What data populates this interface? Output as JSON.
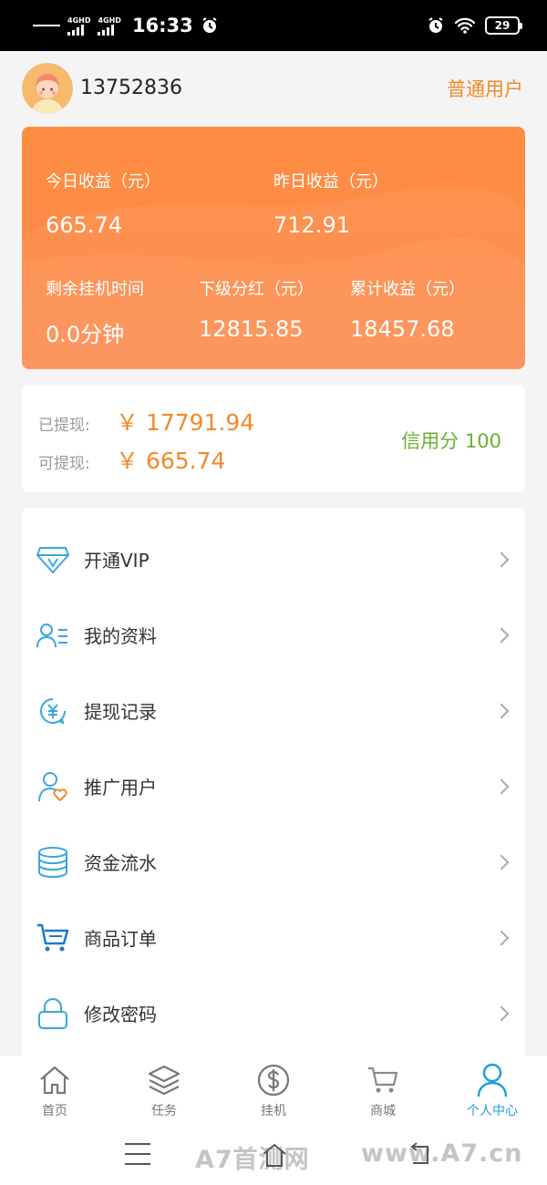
{
  "status_bar": {
    "signal1_label": "4GHD",
    "signal2_label": "4GHD",
    "time": "16:33",
    "battery": "29"
  },
  "header": {
    "username": "13752836",
    "user_level": "普通用户"
  },
  "earnings": {
    "today": {
      "label": "今日收益（元）",
      "value": "665.74"
    },
    "yesterday": {
      "label": "昨日收益（元）",
      "value": "712.91"
    },
    "remaining": {
      "label": "剩余挂机时间",
      "value": "0.0分钟"
    },
    "sub_bonus": {
      "label": "下级分红（元）",
      "value": "12815.85"
    },
    "total": {
      "label": "累计收益（元）",
      "value": "18457.68"
    }
  },
  "withdraw": {
    "withdrawn_label": "已提现:",
    "withdrawn_value": "￥ 17791.94",
    "available_label": "可提现:",
    "available_value": "￥ 665.74",
    "credit": "信用分 100"
  },
  "menu": [
    {
      "label": "开通VIP",
      "icon": "diamond-vip-icon"
    },
    {
      "label": "我的资料",
      "icon": "user-profile-icon"
    },
    {
      "label": "提现记录",
      "icon": "yuan-record-icon"
    },
    {
      "label": "推广用户",
      "icon": "user-heart-icon"
    },
    {
      "label": "资金流水",
      "icon": "coin-stack-icon"
    },
    {
      "label": "商品订单",
      "icon": "cart-icon"
    },
    {
      "label": "修改密码",
      "icon": "lock-icon"
    }
  ],
  "tabs": [
    {
      "label": "首页",
      "icon": "home-icon"
    },
    {
      "label": "任务",
      "icon": "layers-icon"
    },
    {
      "label": "挂机",
      "icon": "dollar-icon"
    },
    {
      "label": "商城",
      "icon": "shop-cart-icon"
    },
    {
      "label": "个人中心",
      "icon": "person-icon"
    }
  ],
  "watermark": {
    "left": "A7首测网",
    "right": "www.A7.cn"
  },
  "colors": {
    "accent_orange": "#f08a2a",
    "card_orange": "#fd8a45",
    "credit_green": "#68b22f",
    "icon_blue": "#1d9fd8"
  }
}
